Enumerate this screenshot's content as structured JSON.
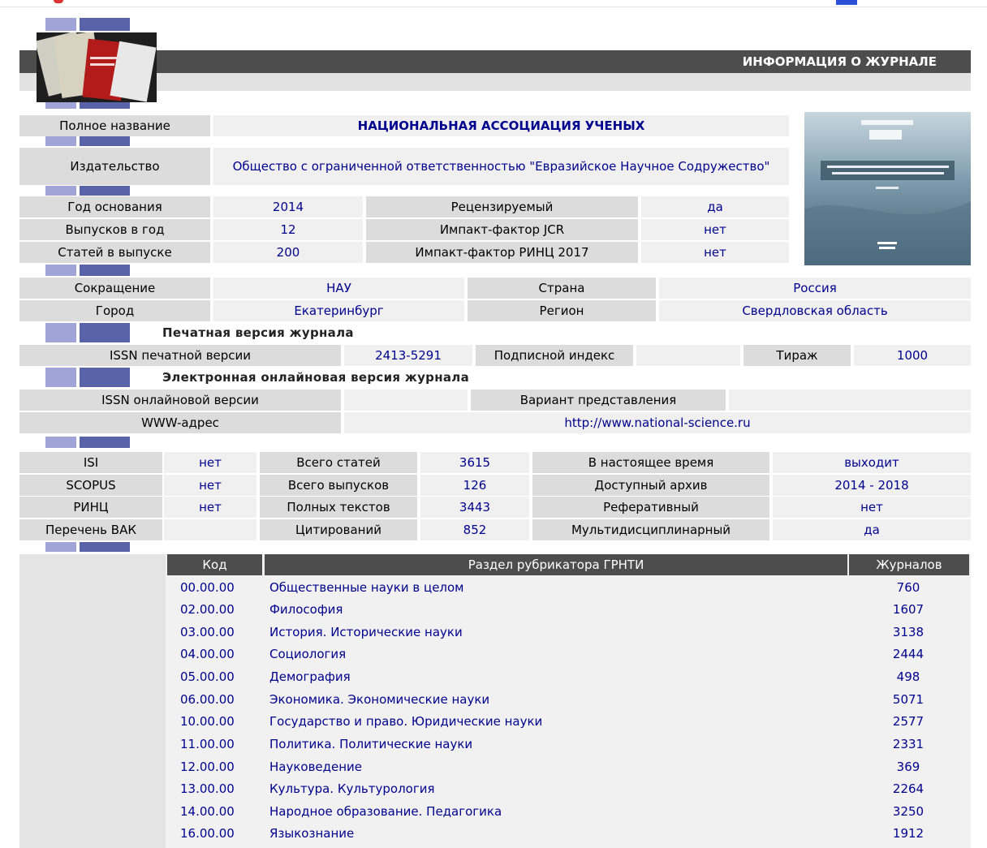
{
  "header": {
    "title": "ИНФОРМАЦИЯ О ЖУРНАЛЕ"
  },
  "main": {
    "full_name_label": "Полное название",
    "full_name": "НАЦИОНАЛЬНАЯ АССОЦИАЦИЯ УЧЕНЫХ",
    "publisher_label": "Издательство",
    "publisher": "Общество с ограниченной ответственностью \"Евразийское Научное Содружество\"",
    "founded_label": "Год основания",
    "founded": "2014",
    "reviewed_label": "Рецензируемый",
    "reviewed": "да",
    "issues_label": "Выпусков в год",
    "issues": "12",
    "jcr_label": "Импакт-фактор JCR",
    "jcr": "нет",
    "articles_label": "Статей в выпуске",
    "articles": "200",
    "rinc_if_label": "Импакт-фактор РИНЦ 2017",
    "rinc_if": "нет"
  },
  "location": {
    "abbr_label": "Сокращение",
    "abbr": "НАУ",
    "country_label": "Страна",
    "country": "Россия",
    "city_label": "Город",
    "city": "Екатеринбург",
    "region_label": "Регион",
    "region": "Свердловская область"
  },
  "print": {
    "title": "Печатная версия журнала",
    "issn_label": "ISSN печатной версии",
    "issn": "2413-5291",
    "subscr_label": "Подписной индекс",
    "subscr": "",
    "circ_label": "Тираж",
    "circ": "1000"
  },
  "online": {
    "title": "Электронная онлайновая версия журнала",
    "issn_label": "ISSN онлайновой версии",
    "issn": "",
    "variant_label": "Вариант представления",
    "variant": "",
    "www_label": "WWW-адрес",
    "www": "http://www.national-science.ru"
  },
  "stats": [
    {
      "l1": "ISI",
      "v1": "нет",
      "l2": "Всего статей",
      "v2": "3615",
      "l3": "В настоящее время",
      "v3": "выходит"
    },
    {
      "l1": "SCOPUS",
      "v1": "нет",
      "l2": "Всего выпусков",
      "v2": "126",
      "l3": "Доступный архив",
      "v3": "2014 - 2018"
    },
    {
      "l1": "РИНЦ",
      "v1": "нет",
      "l2": "Полных текстов",
      "v2": "3443",
      "l3": "Реферативный",
      "v3": "нет"
    },
    {
      "l1": "Перечень ВАК",
      "v1": "",
      "l2": "Цитирований",
      "v2": "852",
      "l3": "Мультидисциплинарный",
      "v3": "да"
    }
  ],
  "rubricator": {
    "headers": {
      "code": "Код",
      "section": "Раздел рубрикатора ГРНТИ",
      "journals": "Журналов"
    },
    "rows": [
      {
        "code": "00.00.00",
        "name": "Общественные науки в целом",
        "count": "760"
      },
      {
        "code": "02.00.00",
        "name": "Философия",
        "count": "1607"
      },
      {
        "code": "03.00.00",
        "name": "История. Исторические науки",
        "count": "3138"
      },
      {
        "code": "04.00.00",
        "name": "Социология",
        "count": "2444"
      },
      {
        "code": "05.00.00",
        "name": "Демография",
        "count": "498"
      },
      {
        "code": "06.00.00",
        "name": "Экономика. Экономические науки",
        "count": "5071"
      },
      {
        "code": "10.00.00",
        "name": "Государство и право. Юридические науки",
        "count": "2577"
      },
      {
        "code": "11.00.00",
        "name": "Политика. Политические науки",
        "count": "2331"
      },
      {
        "code": "12.00.00",
        "name": "Науковедение",
        "count": "369"
      },
      {
        "code": "13.00.00",
        "name": "Культура. Культурология",
        "count": "2264"
      },
      {
        "code": "14.00.00",
        "name": "Народное образование. Педагогика",
        "count": "3250"
      },
      {
        "code": "16.00.00",
        "name": "Языкознание",
        "count": "1912"
      }
    ]
  }
}
